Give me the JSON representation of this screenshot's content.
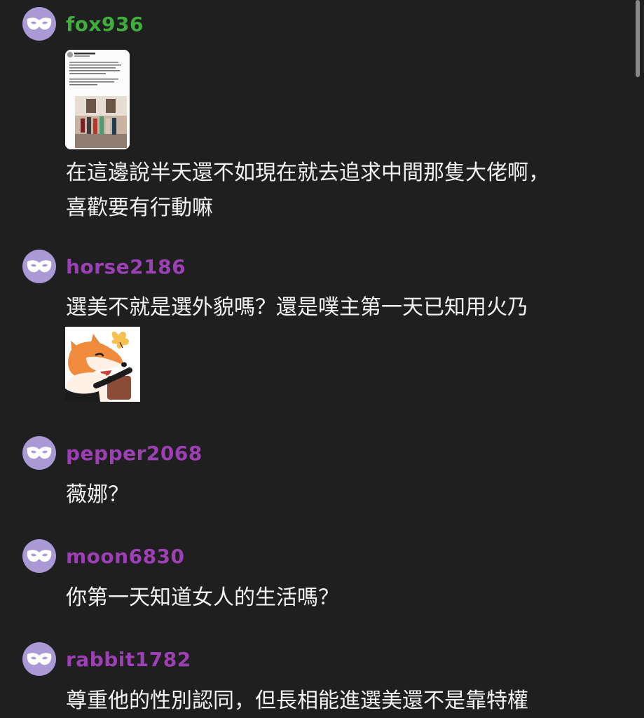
{
  "colors": {
    "background": "#1f1f1f",
    "avatar": "#a99ad6",
    "username_green": "#3fae3a",
    "username_purple": "#9d3fb5",
    "text": "#f2f2f2"
  },
  "comments": [
    {
      "username": "fox936",
      "username_color": "#3fae3a",
      "avatar_icon": "mask-icon",
      "attachment": "tweet-screenshot-thumbnail",
      "text": "在這邊說半天還不如現在就去追求中間那隻大佬啊，\n喜歡要有行動嘛"
    },
    {
      "username": "horse2186",
      "username_color": "#9d3fb5",
      "avatar_icon": "mask-icon",
      "text": "選美不就是選外貌嗎？還是噗主第一天已知用火乃",
      "attachment": "fox-sticker"
    },
    {
      "username": "pepper2068",
      "username_color": "#9d3fb5",
      "avatar_icon": "mask-icon",
      "text": "薇娜？"
    },
    {
      "username": "moon6830",
      "username_color": "#9d3fb5",
      "avatar_icon": "mask-icon",
      "text": "你第一天知道女人的生活嗎？"
    },
    {
      "username": "rabbit1782",
      "username_color": "#9d3fb5",
      "avatar_icon": "mask-icon",
      "text": "尊重他的性別認同，但長相能進選美還不是靠特權"
    }
  ]
}
